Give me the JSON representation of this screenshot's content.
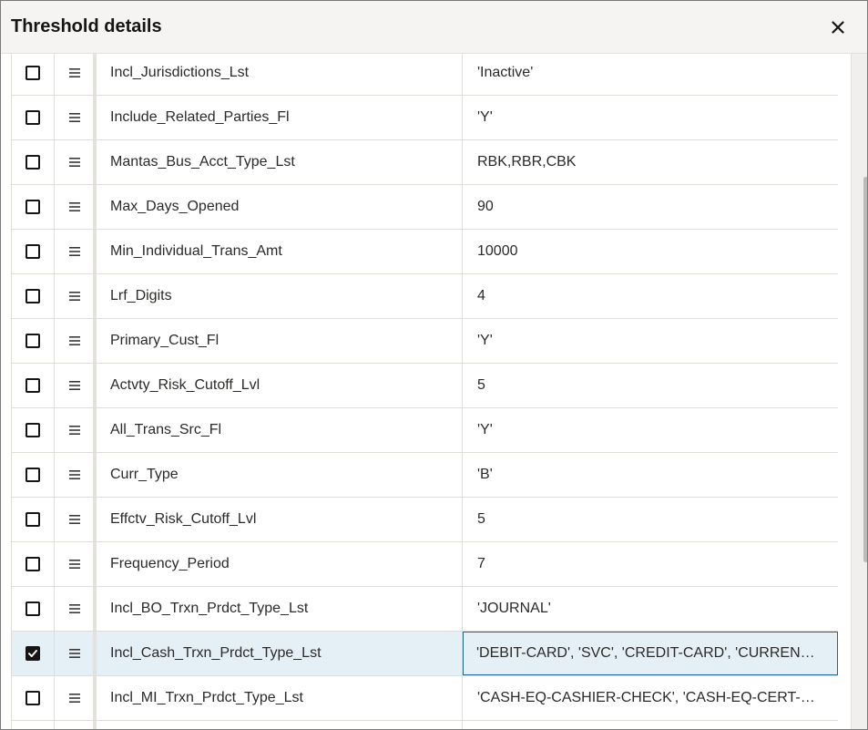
{
  "dialog": {
    "title": "Threshold details",
    "close_icon": "close-icon"
  },
  "rows": [
    {
      "name": "Incl_Jurisdictions_Lst",
      "value": "'Inactive'",
      "checked": false
    },
    {
      "name": "Include_Related_Parties_Fl",
      "value": "'Y'",
      "checked": false
    },
    {
      "name": "Mantas_Bus_Acct_Type_Lst",
      "value": "RBK,RBR,CBK",
      "checked": false
    },
    {
      "name": "Max_Days_Opened",
      "value": "90",
      "checked": false
    },
    {
      "name": "Min_Individual_Trans_Amt",
      "value": "10000",
      "checked": false
    },
    {
      "name": "Lrf_Digits",
      "value": "4",
      "checked": false
    },
    {
      "name": "Primary_Cust_Fl",
      "value": "'Y'",
      "checked": false
    },
    {
      "name": "Actvty_Risk_Cutoff_Lvl",
      "value": "5",
      "checked": false
    },
    {
      "name": "All_Trans_Src_Fl",
      "value": "'Y'",
      "checked": false
    },
    {
      "name": "Curr_Type",
      "value": "'B'",
      "checked": false
    },
    {
      "name": "Effctv_Risk_Cutoff_Lvl",
      "value": "5",
      "checked": false
    },
    {
      "name": "Frequency_Period",
      "value": "7",
      "checked": false
    },
    {
      "name": "Incl_BO_Trxn_Prdct_Type_Lst",
      "value": "'JOURNAL'",
      "checked": false
    },
    {
      "name": "Incl_Cash_Trxn_Prdct_Type_Lst",
      "value": "'DEBIT-CARD', 'SVC', 'CREDIT-CARD', 'CURRENCY',...",
      "checked": true
    },
    {
      "name": "Incl_MI_Trxn_Prdct_Type_Lst",
      "value": "'CASH-EQ-CASHIER-CHECK', 'CASH-EQ-CERT-CH...",
      "checked": false
    },
    {
      "name": "",
      "value": "",
      "checked": false
    }
  ],
  "colors": {
    "header_bg": "#f5f4f2",
    "selected_row_bg": "#e5f0f6",
    "focus_border": "#236591"
  }
}
